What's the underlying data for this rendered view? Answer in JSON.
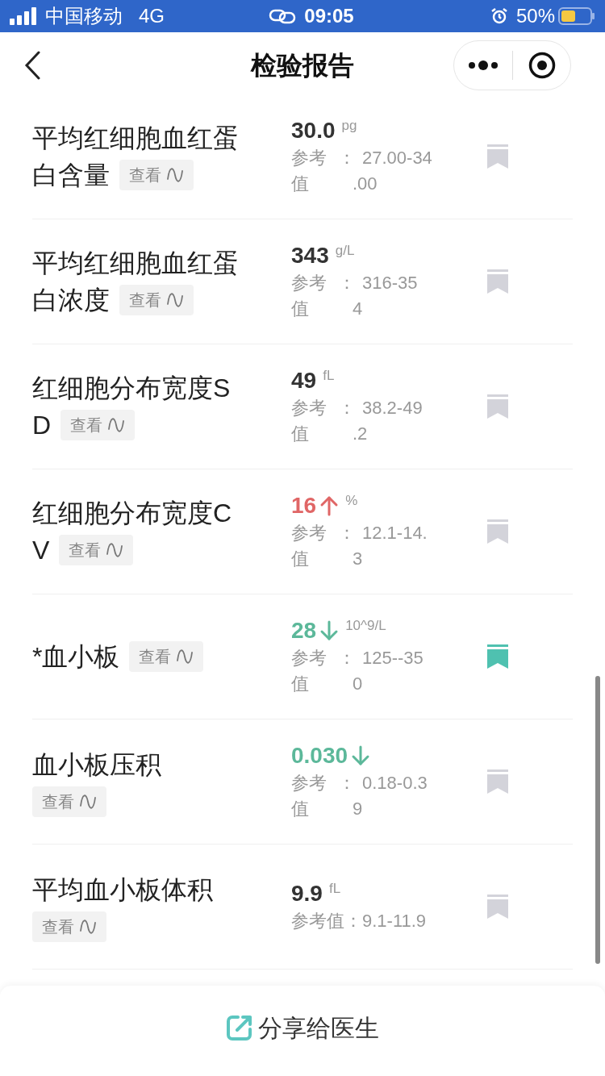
{
  "status_bar": {
    "carrier": "中国移动",
    "network": "4G",
    "time": "09:05",
    "battery": "50%"
  },
  "nav": {
    "title": "检验报告"
  },
  "items": [
    {
      "name_lines": [
        "平均红细胞血红蛋",
        "白含量"
      ],
      "view": "查看",
      "value": "30.0",
      "high": false,
      "low": false,
      "unit": "pg",
      "reference": [
        {
          "label": "参考",
          "sep": "：",
          "value": "27.00-34"
        },
        {
          "label": "值",
          "value": ".00"
        }
      ],
      "bookmarked": false
    },
    {
      "name_lines": [
        "平均红细胞血红蛋",
        "白浓度"
      ],
      "view": "查看",
      "value": "343",
      "high": false,
      "low": false,
      "unit": "g/L",
      "reference": [
        {
          "label": "参考",
          "sep": "：",
          "value": "316-35"
        },
        {
          "label": "值",
          "value": "4"
        }
      ],
      "bookmarked": false
    },
    {
      "name_lines": [
        "红细胞分布宽度S",
        "D"
      ],
      "view": "查看",
      "value": "49",
      "high": false,
      "low": false,
      "unit": "fL",
      "reference": [
        {
          "label": "参考",
          "sep": "：",
          "value": "38.2-49"
        },
        {
          "label": "值",
          "value": ".2"
        }
      ],
      "bookmarked": false
    },
    {
      "name_lines": [
        "红细胞分布宽度C",
        "V"
      ],
      "view": "查看",
      "value": "16",
      "high": true,
      "low": false,
      "unit": "%",
      "reference": [
        {
          "label": "参考",
          "sep": "：",
          "value": "12.1-14."
        },
        {
          "label": "值",
          "value": "3"
        }
      ],
      "bookmarked": false
    },
    {
      "name_lines": [
        "*血小板"
      ],
      "view": "查看",
      "value": "28",
      "high": false,
      "low": true,
      "unit": "10^9/L",
      "reference": [
        {
          "label": "参考",
          "sep": "：",
          "value": "125--35"
        },
        {
          "label": "值",
          "value": "0"
        }
      ],
      "bookmarked": true
    },
    {
      "name_lines": [
        "血小板压积"
      ],
      "view": "查看",
      "value": "0.030",
      "high": false,
      "low": true,
      "reference": [
        {
          "label": "参考",
          "sep": "：",
          "value": "0.18-0.3"
        },
        {
          "label": "值",
          "value": "9"
        }
      ],
      "bookmarked": false
    },
    {
      "name_lines": [
        "平均血小板体积"
      ],
      "view": "查看",
      "value": "9.9",
      "high": false,
      "low": false,
      "unit": "fL",
      "reference": [
        {
          "label": "参考值：",
          "value": "9.1-11.9"
        }
      ],
      "bookmarked": false
    }
  ],
  "share": {
    "label": "分享给医生"
  }
}
